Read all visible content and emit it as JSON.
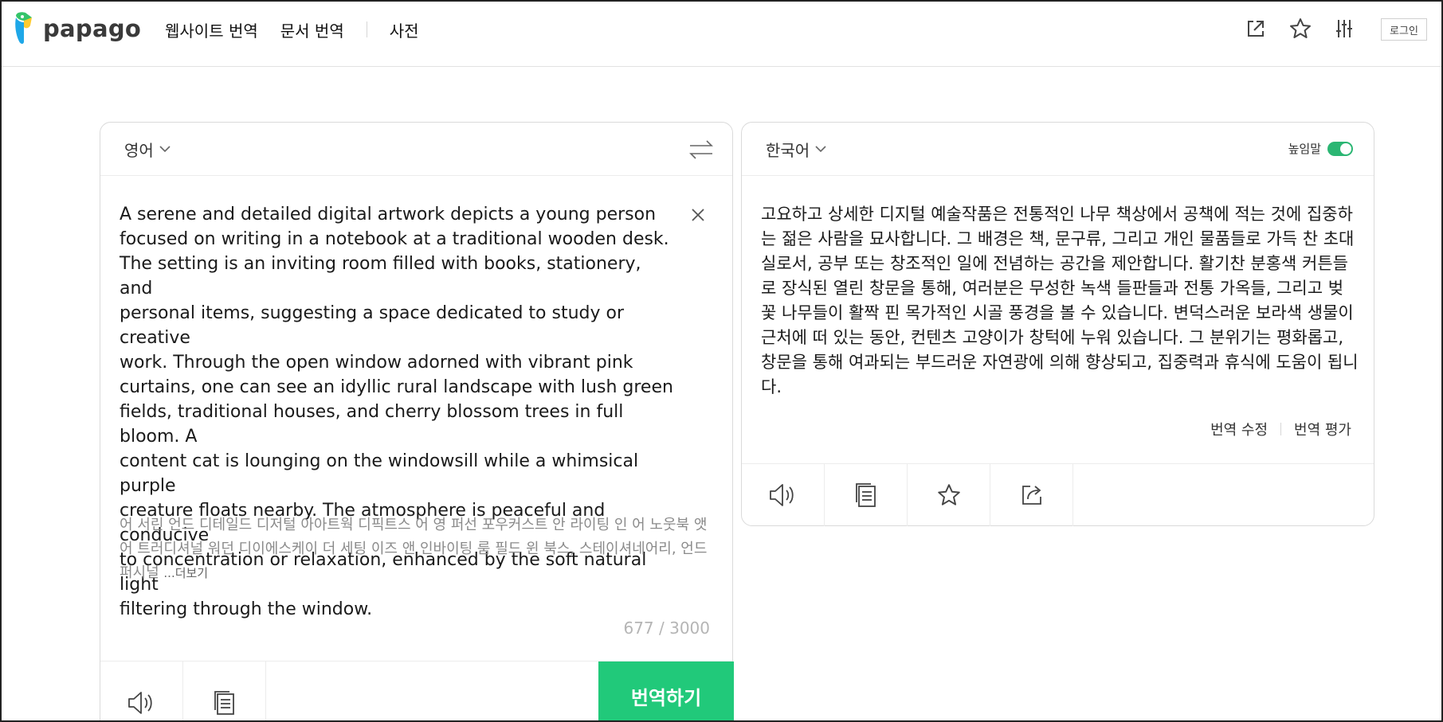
{
  "header": {
    "logo_text": "papago",
    "nav": [
      "웹사이트 번역",
      "문서 번역",
      "사전"
    ],
    "login_label": "로그인",
    "icons": [
      "open-in-new-icon",
      "star-icon",
      "settings-sliders-icon"
    ]
  },
  "source": {
    "language": "영어",
    "text": "A serene and detailed digital artwork depicts a young person\nfocused on writing in a notebook at a traditional wooden desk.\nThe setting is an inviting room filled with books, stationery, and\npersonal items, suggesting a space dedicated to study or creative\nwork. Through the open window adorned with vibrant pink\ncurtains, one can see an idyllic rural landscape with lush green\nfields, traditional houses, and cherry blossom trees in full bloom. A\ncontent cat is lounging on the windowsill while a whimsical purple\ncreature floats nearby. The atmosphere is peaceful and conducive\nto concentration or relaxation, enhanced by the soft natural light\nfiltering through the window.",
    "pronunciation": "어 서린 언드 디테일드 디저털 아아트웍 디픽트스 어 영 퍼선 포우커스트 안 라이팅 인 어 노웃북 앳 어 트러디셔널 워던 디이에스케이 더 세팅 이즈 앤 인바이팅 룸 필드 윈 북스, 스테이셔네어리, 언드 퍼시널 ",
    "more_label": "...더보기",
    "count": "677 / 3000",
    "translate_button": "번역하기"
  },
  "target": {
    "language": "한국어",
    "honorific_label": "높임말",
    "honorific_on": true,
    "text": "고요하고 상세한 디지털 예술작품은 전통적인 나무 책상에서 공책에 적는 것에 집중하는 젊은 사람을 묘사합니다. 그 배경은 책, 문구류, 그리고 개인 물품들로 가득 찬 초대실로서, 공부 또는 창조적인 일에 전념하는 공간을 제안합니다. 활기찬 분홍색 커튼들로 장식된 열린 창문을 통해, 여러분은 무성한 녹색 들판들과 전통 가옥들, 그리고 벚꽃 나무들이 활짝 핀 목가적인 시골 풍경을 볼 수 있습니다. 변덕스러운 보라색 생물이 근처에 떠 있는 동안, 컨텐츠 고양이가 창턱에 누워 있습니다. 그 분위기는 평화롭고, 창문을 통해 여과되는 부드러운 자연광에 의해 향상되고, 집중력과 휴식에 도움이 됩니다.",
    "edit_label": "번역 수정",
    "rate_label": "번역 평가"
  },
  "colors": {
    "accent_green": "#21c97a",
    "toggle_green": "#2bb673",
    "logo_blue": "#1ea7e8",
    "logo_green": "#35c46a",
    "logo_yellow": "#ffcb2f"
  }
}
